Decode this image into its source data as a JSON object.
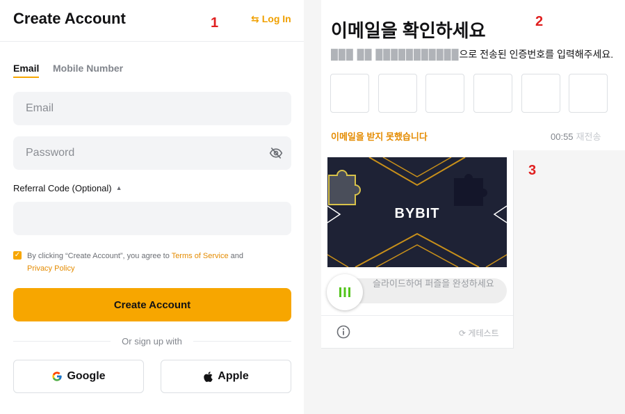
{
  "left": {
    "title": "Create Account",
    "login_link": "Log In",
    "step_label": "1",
    "tabs": [
      "Email",
      "Mobile Number"
    ],
    "email_placeholder": "Email",
    "password_placeholder": "Password",
    "referral_label": "Referral Code (Optional)",
    "referral_value": "",
    "agree_prefix": "By clicking “Create Account”, you agree to ",
    "terms_link": "Terms of Service",
    "agree_and": " and",
    "privacy_link": "Privacy Policy",
    "create_button": "Create Account",
    "or_sign_up": "Or sign up with",
    "google_button": "Google",
    "apple_button": "Apple"
  },
  "verify": {
    "step_label": "2",
    "title": "이메일을 확인하세요",
    "masked_email": "███ ██ ███████████",
    "subtitle": "으로 전송된 인증번호를 입력해주세요.",
    "otp_count": 6,
    "no_email": "이메일을 받지 못했습니다",
    "timer": "00:55",
    "resend": "재전송"
  },
  "captcha": {
    "step_label": "3",
    "brand": "BYBIT",
    "slider_text": "슬라이드하여 퍼즐을 완성하세요",
    "provider": "게테스트"
  },
  "colors": {
    "accent": "#f7a600",
    "link": "#e48b00",
    "step_red": "#e02020"
  }
}
